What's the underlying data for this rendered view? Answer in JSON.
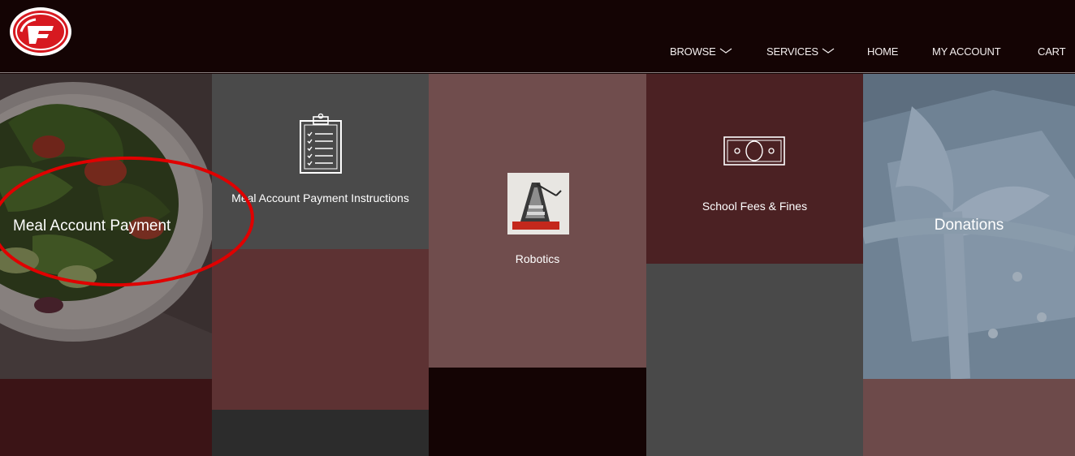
{
  "nav": {
    "browse": "BROWSE",
    "services": "SERVICES",
    "home": "HOME",
    "my_account": "MY ACCOUNT",
    "cart": "CART"
  },
  "tiles": {
    "meal": "Meal Account Payment",
    "instructions": "Meal Account Payment Instructions",
    "robotics": "Robotics",
    "fees": "School Fees & Fines",
    "donations": "Donations"
  },
  "colors": {
    "header_bg": "#140404",
    "highlight_circle": "#e00000",
    "logo_red": "#d71920"
  },
  "icons": {
    "logo": "sf-logo",
    "instructions": "clipboard-checklist-icon",
    "fees": "dollar-bill-icon",
    "robotics": "robotics-thumbnail-image"
  }
}
